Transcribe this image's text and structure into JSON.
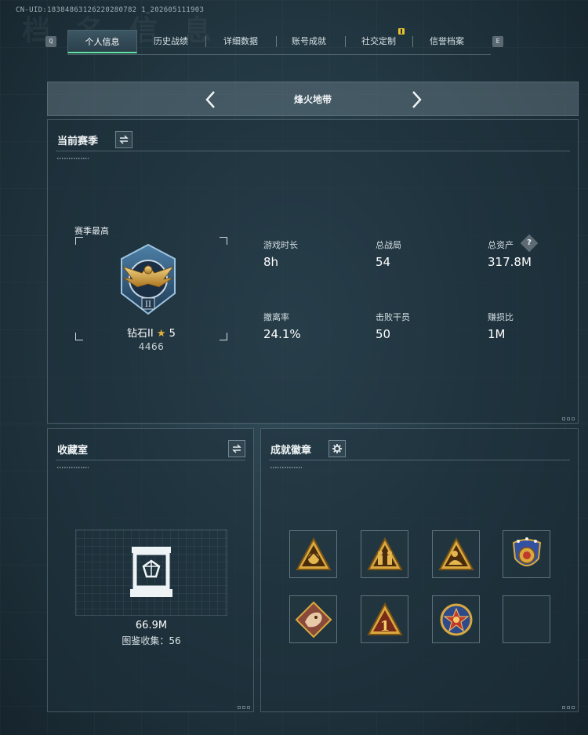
{
  "uid": "CN-UID:18384863126220280782 1_202605111903",
  "nav": {
    "left_key": "Q",
    "right_key": "E",
    "tabs": [
      {
        "label": "个人信息",
        "active": true
      },
      {
        "label": "历史战绩",
        "active": false
      },
      {
        "label": "详细数据",
        "active": false
      },
      {
        "label": "账号成就",
        "active": false
      },
      {
        "label": "社交定制",
        "active": false,
        "badge": true
      },
      {
        "label": "信誉档案",
        "active": false
      }
    ]
  },
  "map_selector": {
    "title": "烽火地带"
  },
  "season": {
    "title": "当前赛季",
    "best_label": "赛季最高",
    "rank_name": "钻石II",
    "rank_stars": "5",
    "rank_score": "4466",
    "stats": [
      {
        "label": "游戏时长",
        "value": "8h"
      },
      {
        "label": "总战局",
        "value": "54"
      },
      {
        "label": "总资产",
        "value": "317.8M",
        "help": true
      },
      {
        "label": "撤离率",
        "value": "24.1%"
      },
      {
        "label": "击败干员",
        "value": "50"
      },
      {
        "label": "赚损比",
        "value": "1M"
      }
    ]
  },
  "collection": {
    "title": "收藏室",
    "value": "66.9M",
    "count_text": "图鉴收集：56"
  },
  "badges": {
    "title": "成就徽章",
    "items": [
      {
        "icon": "gold-triangle-emblem-icon"
      },
      {
        "icon": "gold-triangle-soldiers-icon"
      },
      {
        "icon": "gold-triangle-figure-icon"
      },
      {
        "icon": "police-shield-badge-icon"
      },
      {
        "icon": "dragon-diamond-badge-icon"
      },
      {
        "icon": "number-one-triangle-icon"
      },
      {
        "icon": "star-medal-badge-icon"
      },
      {
        "icon": "empty-slot"
      }
    ]
  },
  "colors": {
    "accent": "#64e3a6",
    "gold": "#d9a940"
  }
}
